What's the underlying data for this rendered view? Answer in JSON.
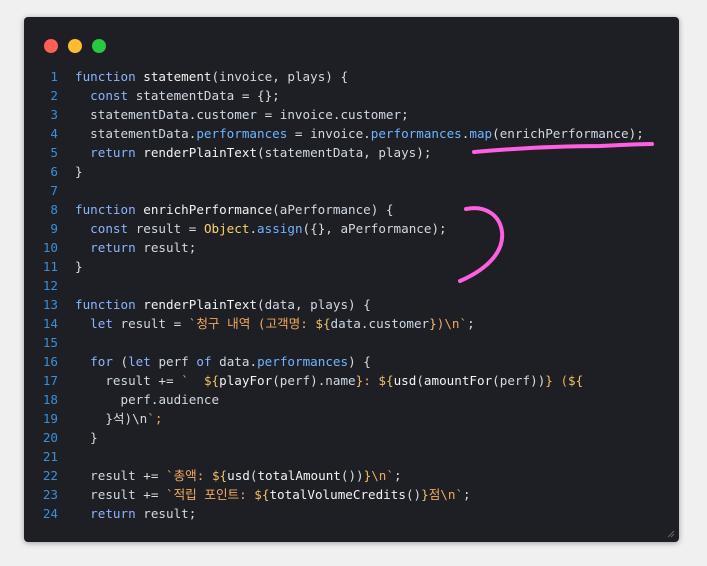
{
  "window": {
    "controls": [
      {
        "name": "close",
        "color": "#ff5f57"
      },
      {
        "name": "minimize",
        "color": "#febc2e"
      },
      {
        "name": "maximize",
        "color": "#28c840"
      }
    ],
    "annotation_color": "#ff5fe0"
  },
  "code_lines": [
    {
      "n": "1",
      "text": "function statement(invoice, plays) {"
    },
    {
      "n": "2",
      "text": "  const statementData = {};"
    },
    {
      "n": "3",
      "text": "  statementData.customer = invoice.customer;"
    },
    {
      "n": "4",
      "text": "  statementData.performances = invoice.performances.map(enrichPerformance);"
    },
    {
      "n": "5",
      "text": "  return renderPlainText(statementData, plays);"
    },
    {
      "n": "6",
      "text": "}"
    },
    {
      "n": "7",
      "text": ""
    },
    {
      "n": "8",
      "text": "function enrichPerformance(aPerformance) {"
    },
    {
      "n": "9",
      "text": "  const result = Object.assign({}, aPerformance);"
    },
    {
      "n": "10",
      "text": "  return result;"
    },
    {
      "n": "11",
      "text": "}"
    },
    {
      "n": "12",
      "text": ""
    },
    {
      "n": "13",
      "text": "function renderPlainText(data, plays) {"
    },
    {
      "n": "14",
      "text": "  let result = `청구 내역 (고객명: ${data.customer})\\n`;"
    },
    {
      "n": "15",
      "text": ""
    },
    {
      "n": "16",
      "text": "  for (let perf of data.performances) {"
    },
    {
      "n": "17",
      "text": "    result += `  ${playFor(perf).name}: ${usd(amountFor(perf))} (${"
    },
    {
      "n": "18",
      "text": "      perf.audience"
    },
    {
      "n": "19",
      "text": "    }석)\\n`;"
    },
    {
      "n": "20",
      "text": "  }"
    },
    {
      "n": "21",
      "text": ""
    },
    {
      "n": "22",
      "text": "  result += `총액: ${usd(totalAmount())}\\n`;"
    },
    {
      "n": "23",
      "text": "  result += `적립 포인트: ${totalVolumeCredits()}점\\n`;"
    },
    {
      "n": "24",
      "text": "  return result;"
    }
  ]
}
